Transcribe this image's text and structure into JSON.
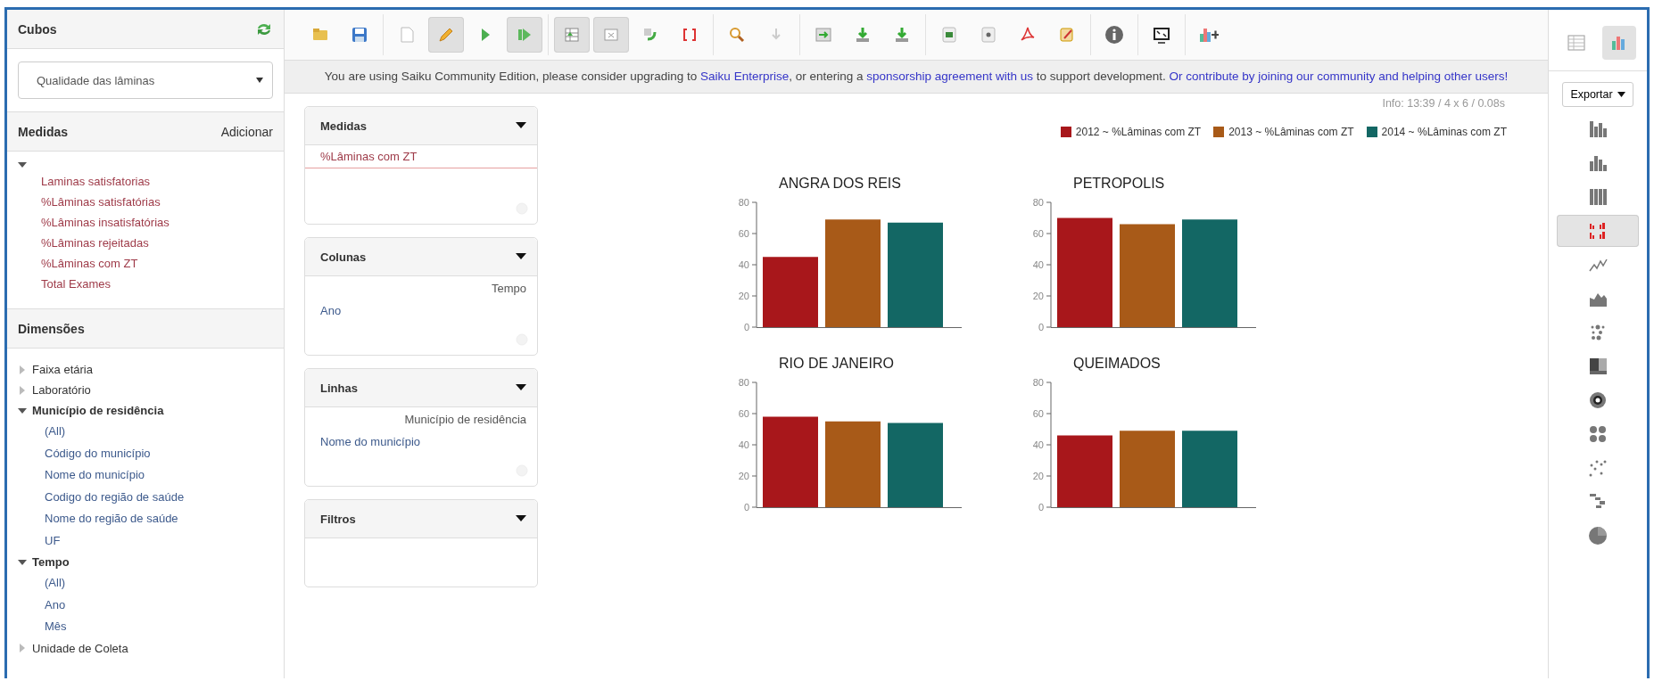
{
  "cubes": {
    "title": "Cubos",
    "selected_cube": "Qualidade das lâminas"
  },
  "measures": {
    "title": "Medidas",
    "action": "Adicionar",
    "expanded": true,
    "items": [
      "Laminas satisfatorias",
      "%Lâminas satisfatórias",
      "%Lâminas insatisfatórias",
      "%Lâminas rejeitadas",
      "%Lâminas com ZT",
      "Total Exames"
    ]
  },
  "dimensions": {
    "title": "Dimensões",
    "tree": [
      {
        "label": "Faixa etária",
        "expanded": false
      },
      {
        "label": "Laboratório",
        "expanded": false
      },
      {
        "label": "Município de residência",
        "expanded": true,
        "children": [
          {
            "label": "(All)"
          },
          {
            "label": "Código do município"
          },
          {
            "label": "Nome do município"
          },
          {
            "label": "Codigo do região de saúde"
          },
          {
            "label": "Nome do região de saúde"
          },
          {
            "label": "UF"
          }
        ]
      },
      {
        "label": "Tempo",
        "expanded": true,
        "children": [
          {
            "label": "(All)"
          },
          {
            "label": "Ano"
          },
          {
            "label": "Mês"
          }
        ]
      },
      {
        "label": "Unidade de Coleta",
        "expanded": false
      }
    ]
  },
  "toolbar": [
    [
      {
        "kind": "folder",
        "pressed": false
      },
      {
        "kind": "save",
        "pressed": false
      }
    ],
    [
      {
        "kind": "new",
        "pressed": false
      },
      {
        "kind": "pencil",
        "pressed": true
      },
      {
        "kind": "play",
        "pressed": false
      },
      {
        "kind": "autorun",
        "pressed": true
      }
    ],
    [
      {
        "kind": "table-refresh",
        "pressed": true
      },
      {
        "kind": "hide-empty",
        "pressed": true
      },
      {
        "kind": "swap",
        "pressed": false
      },
      {
        "kind": "brackets",
        "pressed": false
      }
    ],
    [
      {
        "kind": "magnifier",
        "pressed": false
      },
      {
        "kind": "down",
        "pressed": false
      }
    ],
    [
      {
        "kind": "export-table",
        "pressed": false
      },
      {
        "kind": "download",
        "pressed": false
      },
      {
        "kind": "download",
        "pressed": false
      }
    ],
    [
      {
        "kind": "xls",
        "pressed": false
      },
      {
        "kind": "csv",
        "pressed": false
      },
      {
        "kind": "pdf",
        "pressed": false
      },
      {
        "kind": "edit",
        "pressed": false
      }
    ],
    [
      {
        "kind": "info",
        "pressed": false
      }
    ],
    [
      {
        "kind": "screen",
        "pressed": false
      }
    ],
    [
      {
        "kind": "chart-plus",
        "pressed": false
      }
    ]
  ],
  "notice": [
    {
      "text": "You are using Saiku Community Edition, please consider upgrading to ",
      "kind": "text"
    },
    {
      "text": "Saiku Enterprise",
      "kind": "link"
    },
    {
      "text": ", or entering a ",
      "kind": "text"
    },
    {
      "text": "sponsorship agreement with us",
      "kind": "link"
    },
    {
      "text": " to support development. ",
      "kind": "text"
    },
    {
      "text": "Or contribute by joining our community and helping other users!",
      "kind": "link"
    }
  ],
  "info": "Info: 13:39 / 4 x 6 / 0.08s",
  "panels": [
    {
      "title": "Medidas",
      "items": [
        {
          "kind": "measure",
          "text": "%Lâminas com ZT"
        }
      ]
    },
    {
      "title": "Colunas",
      "items": [
        {
          "kind": "dimension",
          "text": "Tempo"
        },
        {
          "kind": "level",
          "text": "Ano"
        }
      ]
    },
    {
      "title": "Linhas",
      "items": [
        {
          "kind": "dimension",
          "text": "Município de residência"
        },
        {
          "kind": "level",
          "text": "Nome do município"
        }
      ]
    },
    {
      "title": "Filtros"
    }
  ],
  "legend": [
    {
      "label": "2012 ~ %Lâminas com ZT",
      "color": "#a8171b"
    },
    {
      "label": "2013 ~ %Lâminas com ZT",
      "color": "#a85a18"
    },
    {
      "label": "2014 ~ %Lâminas com ZT",
      "color": "#136764"
    }
  ],
  "charts": [
    {
      "chart_data": {
        "type": "bar",
        "title": "ANGRA DOS REIS",
        "values": [
          45,
          69,
          67
        ],
        "ylim": [
          0,
          80
        ],
        "yticks": [
          0,
          20,
          40,
          60,
          80
        ]
      }
    },
    {
      "chart_data": {
        "type": "bar",
        "title": "PETROPOLIS",
        "values": [
          70,
          66,
          69
        ],
        "ylim": [
          0,
          80
        ],
        "yticks": [
          0,
          20,
          40,
          60,
          80
        ]
      }
    },
    {
      "chart_data": {
        "type": "bar",
        "title": "RIO DE JANEIRO",
        "values": [
          58,
          55,
          54
        ],
        "ylim": [
          0,
          80
        ],
        "yticks": [
          0,
          20,
          40,
          60,
          80
        ]
      }
    },
    {
      "chart_data": {
        "type": "bar",
        "title": "QUEIMADOS",
        "values": [
          46,
          49,
          49
        ],
        "ylim": [
          0,
          80
        ],
        "yticks": [
          0,
          20,
          40,
          60,
          80
        ]
      }
    }
  ],
  "view_modes": [
    {
      "kind": "table",
      "selected": false
    },
    {
      "kind": "chart",
      "selected": true
    }
  ],
  "export_button": "Exportar",
  "chart_types": [
    {
      "kind": "bar",
      "selected": false
    },
    {
      "kind": "stacked",
      "selected": false
    },
    {
      "kind": "stacked100",
      "selected": false
    },
    {
      "kind": "multiple",
      "selected": true
    },
    {
      "kind": "line",
      "selected": false
    },
    {
      "kind": "area",
      "selected": false
    },
    {
      "kind": "dots",
      "selected": false
    },
    {
      "kind": "treemap",
      "selected": false
    },
    {
      "kind": "sunburst",
      "selected": false
    },
    {
      "kind": "multi-sunburst",
      "selected": false
    },
    {
      "kind": "scatter",
      "selected": false
    },
    {
      "kind": "waterfall",
      "selected": false
    },
    {
      "kind": "pie",
      "selected": false
    }
  ]
}
